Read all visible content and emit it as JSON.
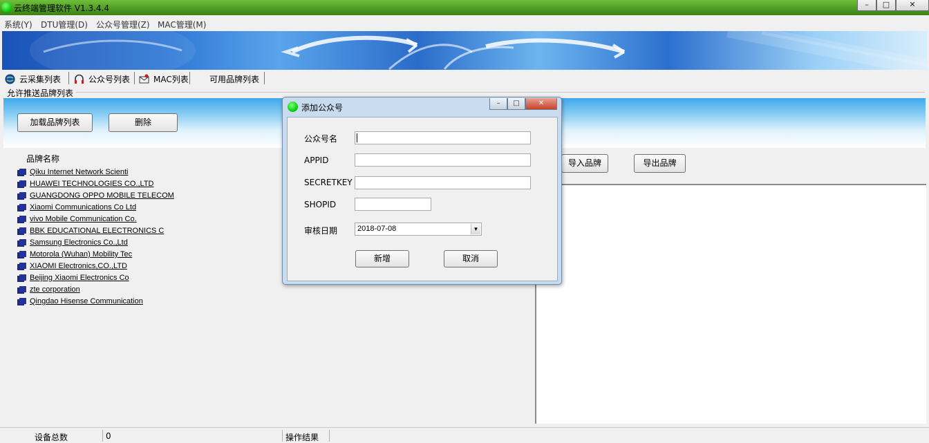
{
  "window": {
    "title": "云终端管理软件 V1.3.4.4",
    "minimize": "–",
    "maximize": "□",
    "close": "✕"
  },
  "menu": [
    "系统(Y)",
    "DTU管理(D)",
    "公众号管理(Z)",
    "MAC管理(M)"
  ],
  "tabs": [
    {
      "label": "云采集列表",
      "icon": "globe-icon"
    },
    {
      "label": "公众号列表",
      "icon": "headset-icon"
    },
    {
      "label": "MAC列表",
      "icon": "mail-icon"
    },
    {
      "label": "可用品牌列表",
      "icon": null
    }
  ],
  "section": {
    "title": "允许推送品牌列表",
    "load_button": "加载品牌列表",
    "delete_button": "删除",
    "import_button": "导入品牌",
    "export_button": "导出品牌"
  },
  "brand_list": {
    "header": "品牌名称",
    "items": [
      "Qiku Internet Network Scienti",
      "HUAWEI TECHNOLOGIES CO.,LTD",
      "GUANGDONG OPPO MOBILE TELECOM",
      "Xiaomi Communications Co Ltd",
      "vivo Mobile Communication Co.",
      "BBK EDUCATIONAL ELECTRONICS C",
      "Samsung Electronics Co.,Ltd",
      "Motorola (Wuhan) Mobility Tec",
      "XIAOMI Electronics,CO.,LTD",
      "Beijing Xiaomi Electronics Co",
      "zte corporation",
      "Qingdao Hisense Communication"
    ]
  },
  "status": {
    "device_total_label": "设备总数",
    "device_total_value": "0",
    "operation_result_label": "操作结果"
  },
  "dialog": {
    "title": "添加公众号",
    "fields": {
      "name_label": "公众号名",
      "name_value": "",
      "appid_label": "APPID",
      "appid_value": "",
      "secretkey_label": "SECRETKEY",
      "secretkey_value": "",
      "shopid_label": "SHOPID",
      "shopid_value": "",
      "date_label": "审核日期",
      "date_value": "2018-07-08"
    },
    "add_button": "新增",
    "cancel_button": "取消"
  },
  "colors": {
    "titlebar": "#4e9a22",
    "status_dot": "#00c800",
    "dialog_frame": "#c9dcef",
    "list_icon": "#1b2a7a"
  }
}
